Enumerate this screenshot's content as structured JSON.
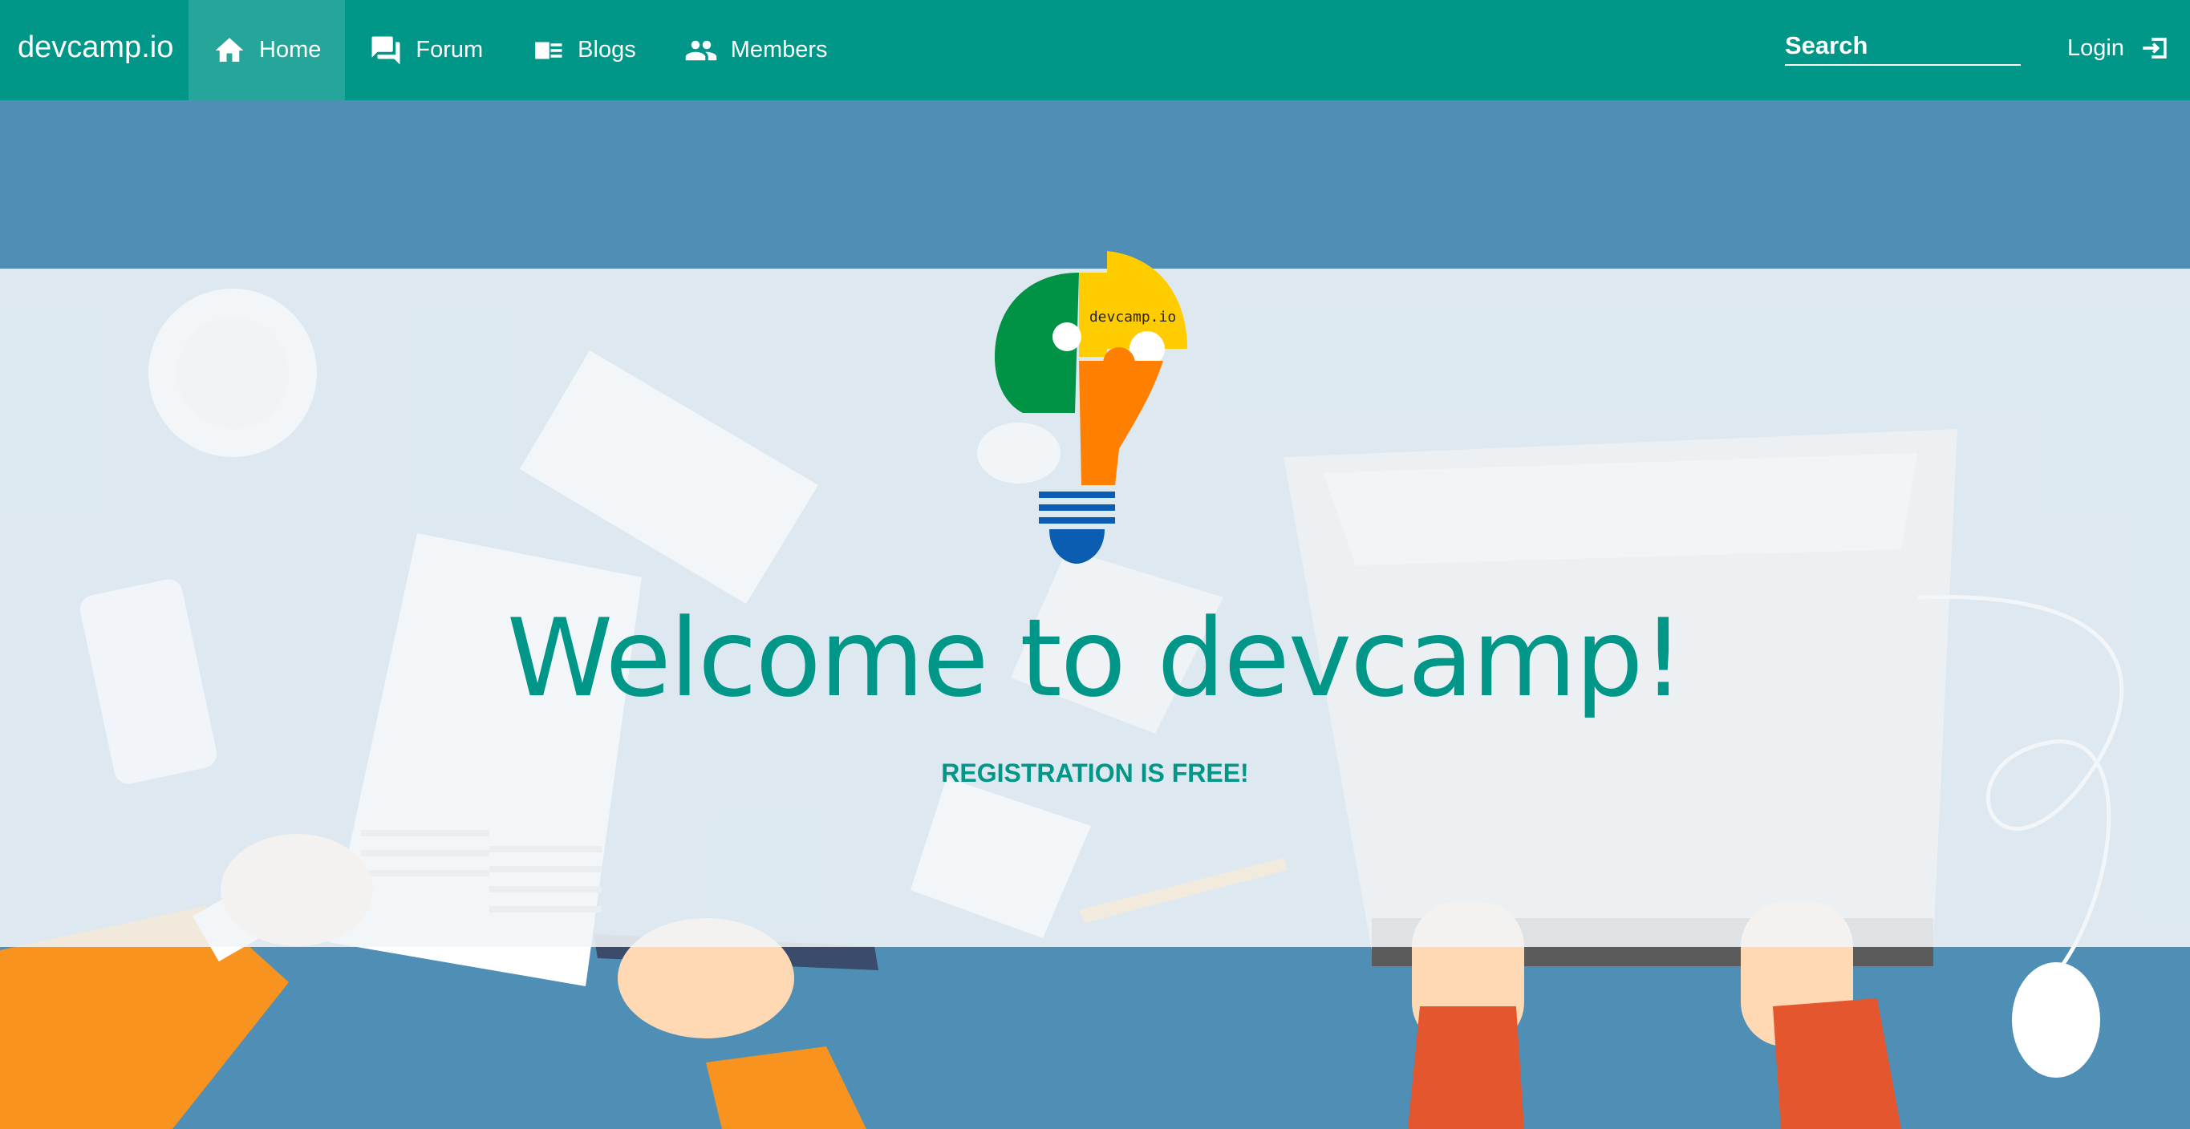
{
  "navbar": {
    "brand": "devcamp.io",
    "items": [
      {
        "label": "Home",
        "icon": "home-icon",
        "active": true
      },
      {
        "label": "Forum",
        "icon": "forum-icon"
      },
      {
        "label": "Blogs",
        "icon": "blogs-icon"
      },
      {
        "label": "Members",
        "icon": "members-icon"
      }
    ],
    "search": {
      "placeholder": "Search",
      "value": ""
    },
    "login": {
      "label": "Login",
      "icon": "login-icon"
    }
  },
  "hero": {
    "logo_text": "devcamp.io",
    "title": "Welcome to devcamp!",
    "subtitle": "REGISTRATION IS FREE!"
  },
  "colors": {
    "primary": "#009688",
    "active_nav": "#26a69a",
    "desk_blue": "#4f8fb6",
    "logo_green": "#009245",
    "logo_yellow": "#ffcc00",
    "logo_orange": "#ff8000",
    "logo_blue": "#0a5db0"
  }
}
